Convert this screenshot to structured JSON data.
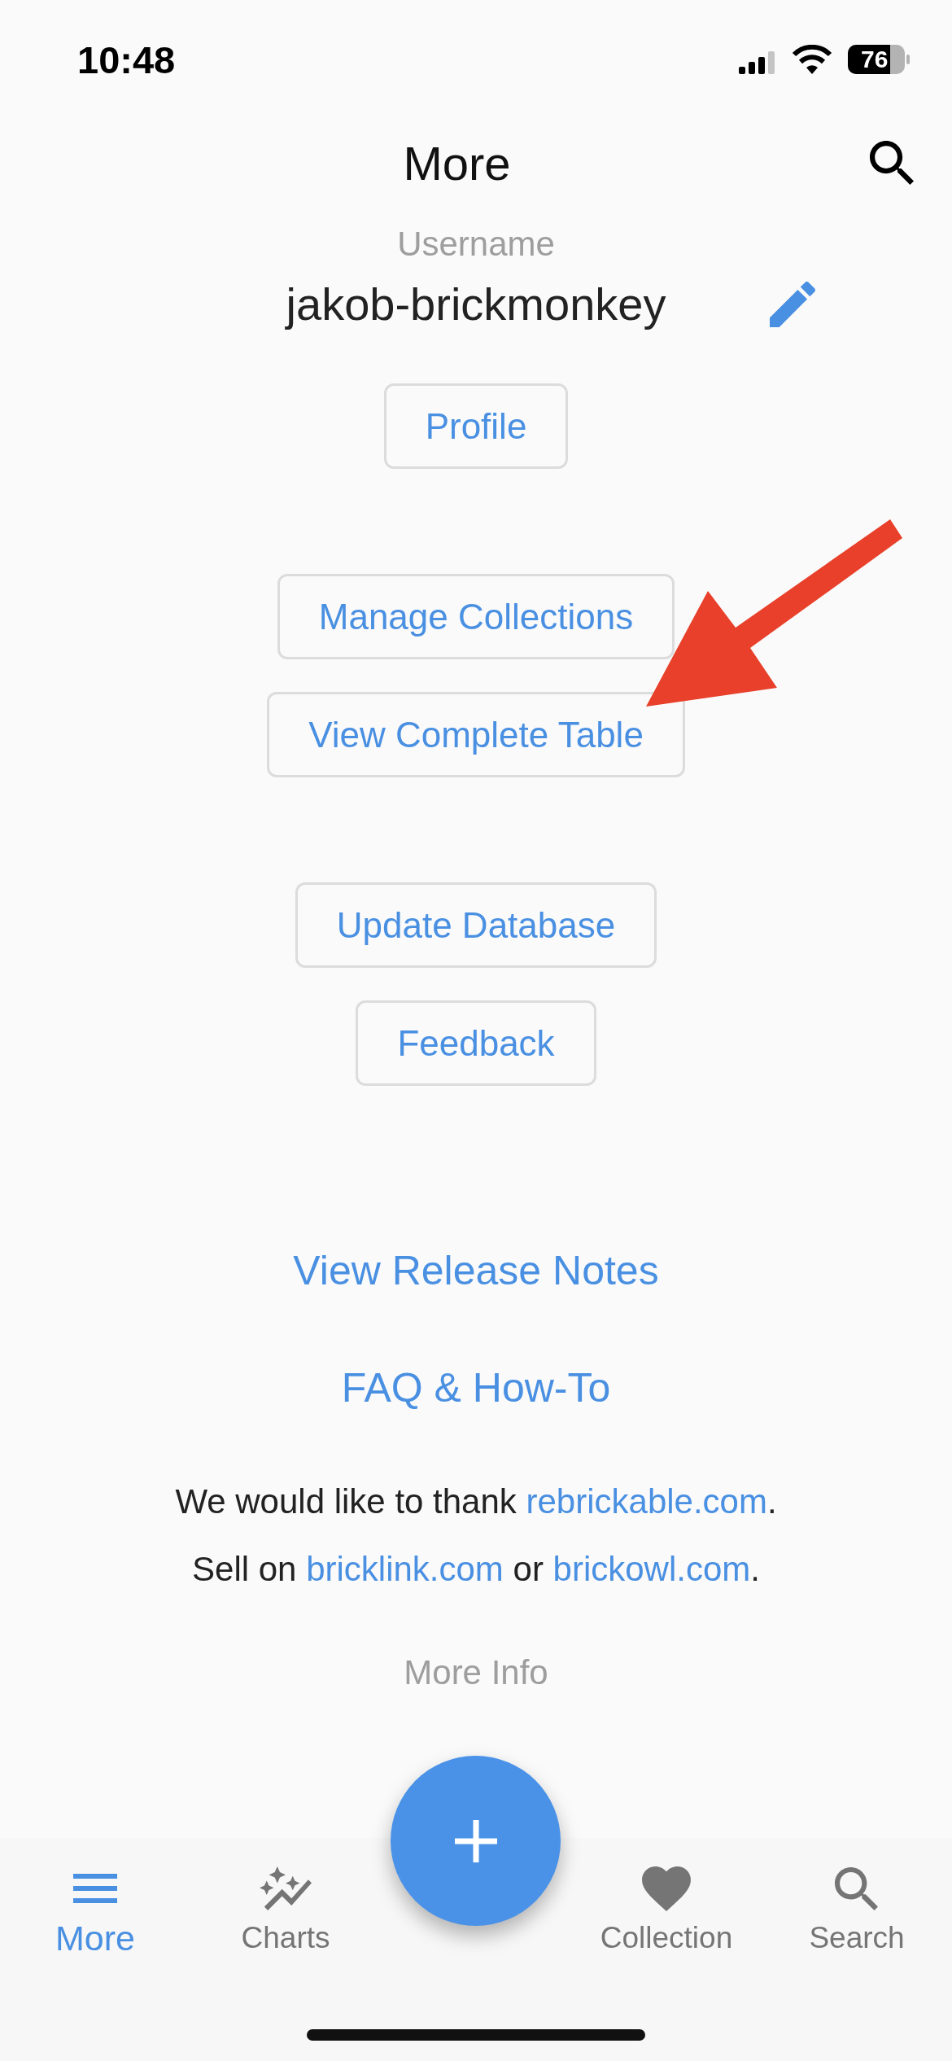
{
  "status_bar": {
    "time": "10:48",
    "battery": "76"
  },
  "header": {
    "title": "More"
  },
  "account": {
    "label": "Username",
    "username": "jakob-brickmonkey",
    "profile_button": "Profile"
  },
  "action_groups": [
    {
      "buttons": [
        "Manage Collections",
        "View Complete Table"
      ]
    },
    {
      "buttons": [
        "Update Database",
        "Feedback"
      ]
    }
  ],
  "links": [
    "View Release Notes",
    "FAQ & How-To"
  ],
  "credits": [
    {
      "parts": [
        {
          "kind": "text",
          "text": "We would like to thank "
        },
        {
          "kind": "link",
          "text": "rebrickable.com"
        },
        {
          "kind": "text",
          "text": "."
        }
      ]
    },
    {
      "parts": [
        {
          "kind": "text",
          "text": "Sell on "
        },
        {
          "kind": "link",
          "text": "bricklink.com"
        },
        {
          "kind": "text",
          "text": " or "
        },
        {
          "kind": "link",
          "text": "brickowl.com"
        },
        {
          "kind": "text",
          "text": "."
        }
      ]
    }
  ],
  "more_info": "More Info",
  "nav": {
    "items": [
      {
        "label": "More",
        "selected": true
      },
      {
        "label": "Charts",
        "selected": false
      },
      {
        "label": "Collection",
        "selected": false
      },
      {
        "label": "Search",
        "selected": false
      }
    ]
  },
  "annotations": [
    {
      "kind": "arrow"
    }
  ]
}
